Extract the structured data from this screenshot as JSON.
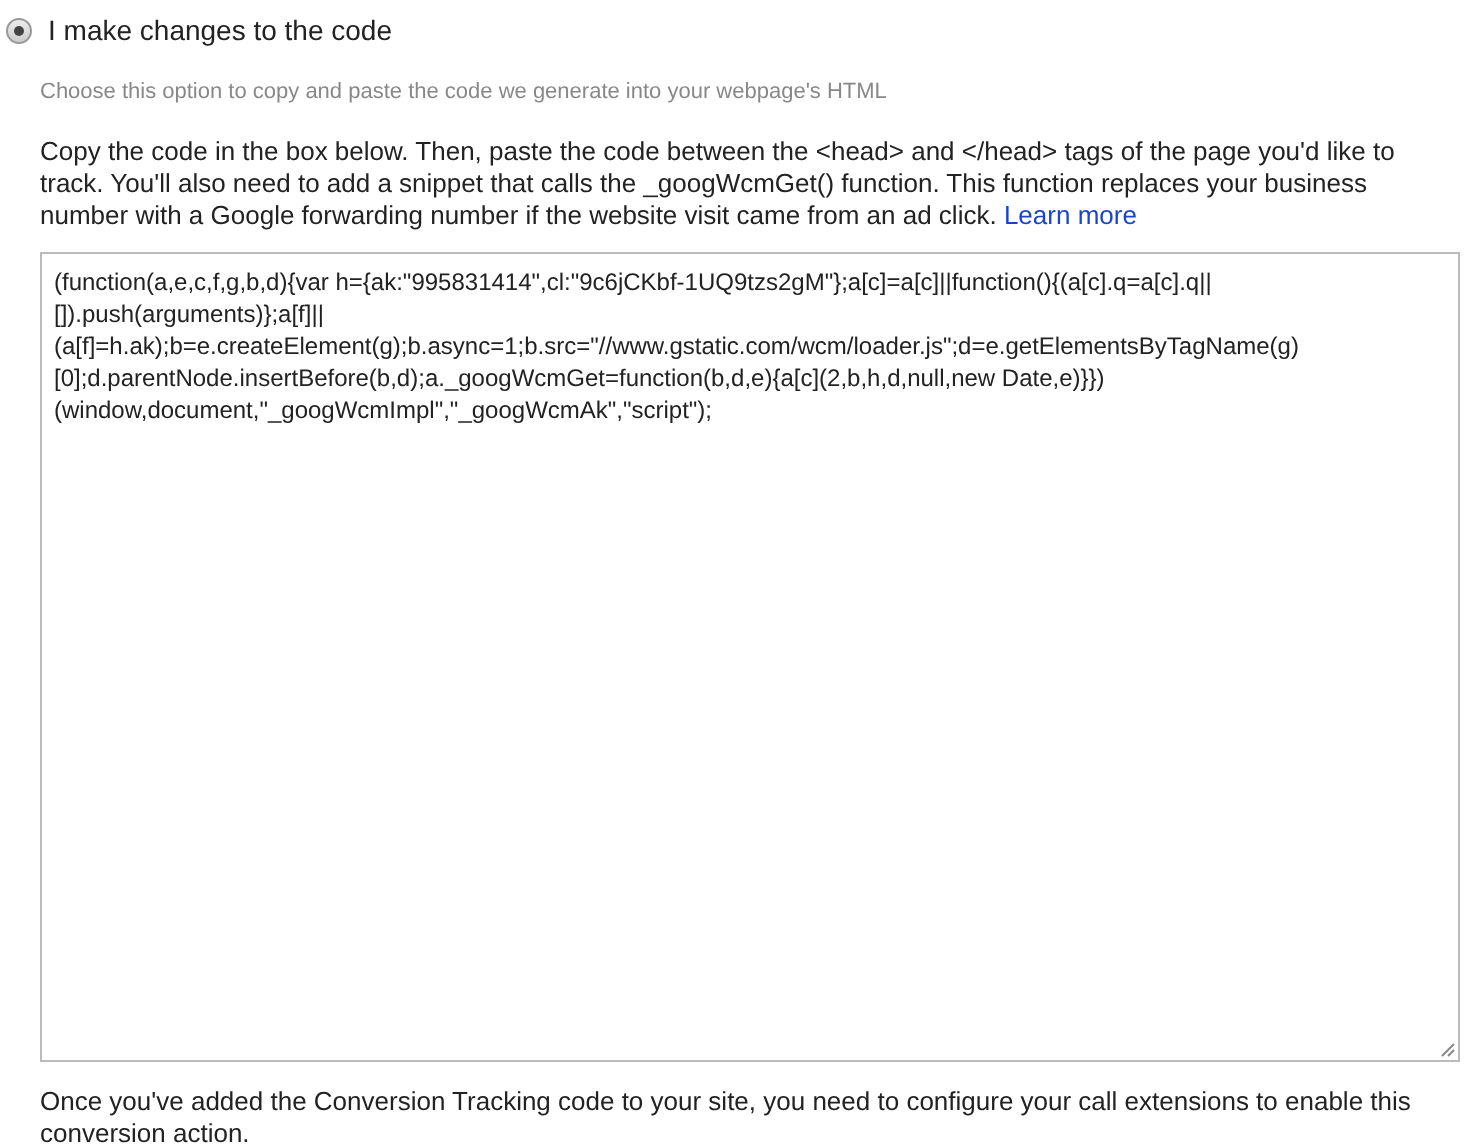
{
  "option": {
    "label": "I make changes to the code",
    "selected": true
  },
  "hint": "Choose this option to copy and paste the code we generate into your webpage's HTML",
  "instructions": {
    "text": "Copy the code in the box below. Then, paste the code between the <head> and </head> tags of the page you'd like to track. You'll also need to add a snippet that calls the _googWcmGet() function. This function replaces your business number with a Google forwarding number if the website visit came from an ad click.",
    "link": "Learn more"
  },
  "code": "(function(a,e,c,f,g,b,d){var h={ak:\"995831414\",cl:\"9c6jCKbf-1UQ9tzs2gM\"};a[c]=a[c]||function(){(a[c].q=a[c].q||[]).push(arguments)};a[f]||(a[f]=h.ak);b=e.createElement(g);b.async=1;b.src=\"//www.gstatic.com/wcm/loader.js\";d=e.getElementsByTagName(g)[0];d.parentNode.insertBefore(b,d);a._googWcmGet=function(b,d,e){a[c](2,b,h,d,null,new Date,e)}})(window,document,\"_googWcmImpl\",\"_googWcmAk\",\"script\");",
  "footer": "Once you've added the Conversion Tracking code to your site, you need to configure your call extensions to enable this conversion action."
}
